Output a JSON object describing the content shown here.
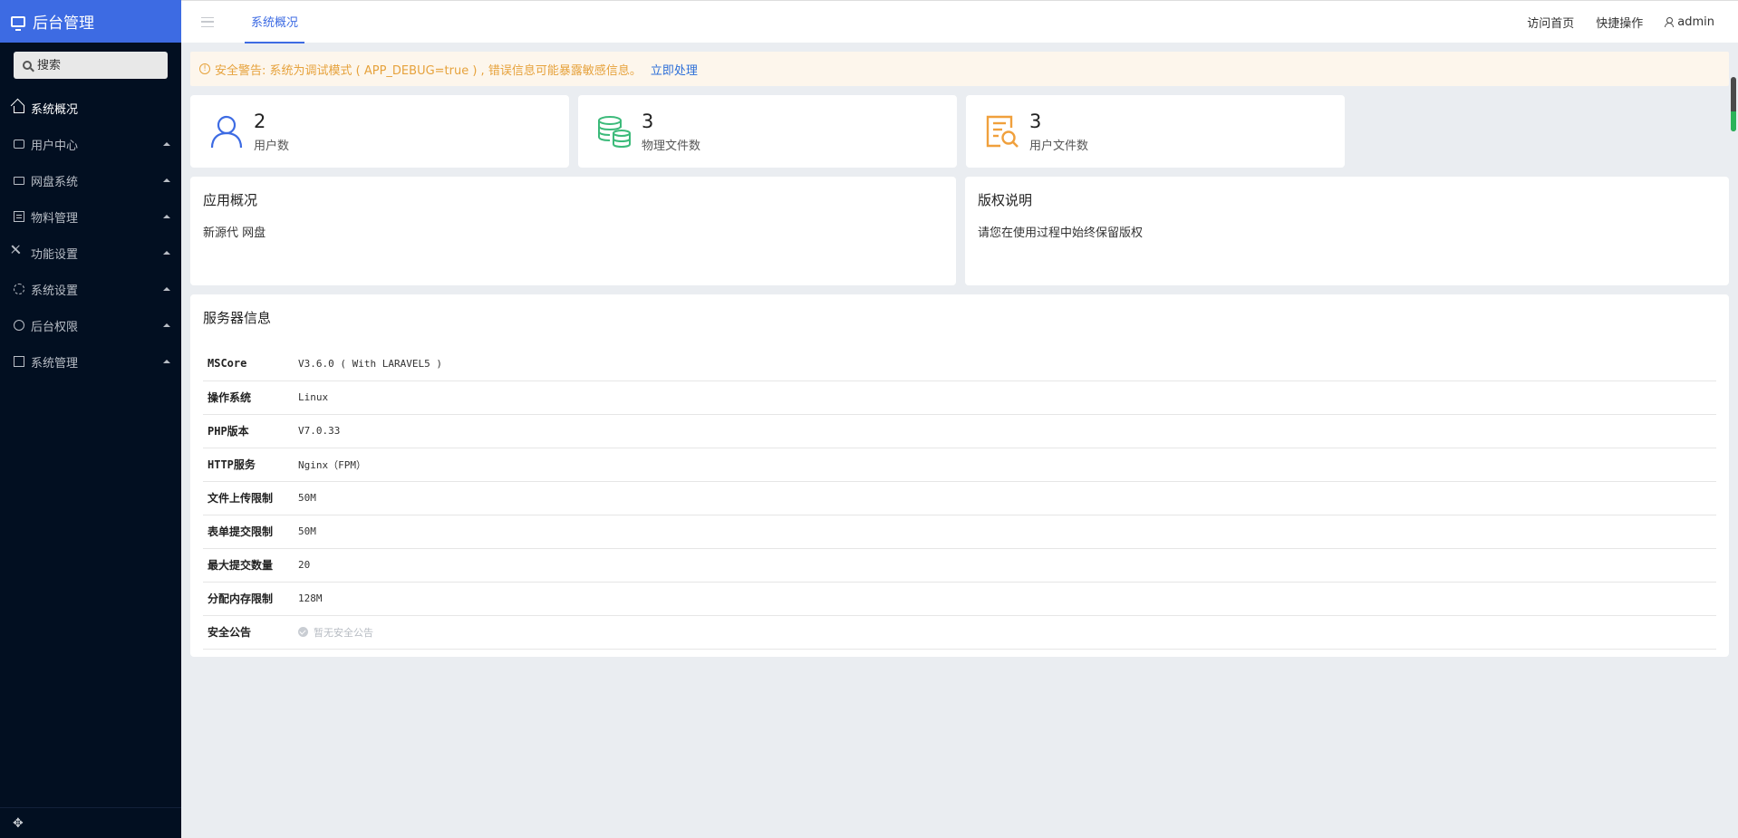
{
  "brand": {
    "title": "后台管理"
  },
  "search": {
    "placeholder": "搜索"
  },
  "sidebar": {
    "items": [
      {
        "label": "系统概况",
        "icon": "home-icon",
        "active": true
      },
      {
        "label": "用户中心",
        "icon": "users-icon"
      },
      {
        "label": "网盘系统",
        "icon": "folder-icon"
      },
      {
        "label": "物料管理",
        "icon": "list-icon"
      },
      {
        "label": "功能设置",
        "icon": "tools-icon"
      },
      {
        "label": "系统设置",
        "icon": "gear-icon"
      },
      {
        "label": "后台权限",
        "icon": "user-circle-icon"
      },
      {
        "label": "系统管理",
        "icon": "chart-icon"
      }
    ],
    "bottom_icon": "move-icon"
  },
  "header": {
    "tab": "系统概况",
    "links": {
      "home": "访问首页",
      "quick": "快捷操作"
    },
    "user": "admin"
  },
  "alert": {
    "text": "安全警告: 系统为调试模式 ( APP_DEBUG=true ) , 错误信息可能暴露敏感信息。",
    "action": "立即处理",
    "color": "#e6a23c"
  },
  "stats": [
    {
      "value": "2",
      "label": "用户数",
      "color": "#3d6be3"
    },
    {
      "value": "3",
      "label": "物理文件数",
      "color": "#3cba7a"
    },
    {
      "value": "3",
      "label": "用户文件数",
      "color": "#f0a03c"
    }
  ],
  "app_panel": {
    "title": "应用概况",
    "text": "新源代 网盘"
  },
  "copyright_panel": {
    "title": "版权说明",
    "text": "请您在使用过程中始终保留版权"
  },
  "server": {
    "title": "服务器信息",
    "rows": [
      {
        "k": "MSCore",
        "v": "V3.6.0 ( With LARAVEL5 )"
      },
      {
        "k": "操作系统",
        "v": "Linux"
      },
      {
        "k": "PHP版本",
        "v": "V7.0.33"
      },
      {
        "k": "HTTP服务",
        "v": "Nginx（FPM）"
      },
      {
        "k": "文件上传限制",
        "v": "50M"
      },
      {
        "k": "表单提交限制",
        "v": "50M"
      },
      {
        "k": "最大提交数量",
        "v": "20"
      },
      {
        "k": "分配内存限制",
        "v": "128M"
      },
      {
        "k": "安全公告",
        "v": "暂无安全公告"
      }
    ]
  }
}
